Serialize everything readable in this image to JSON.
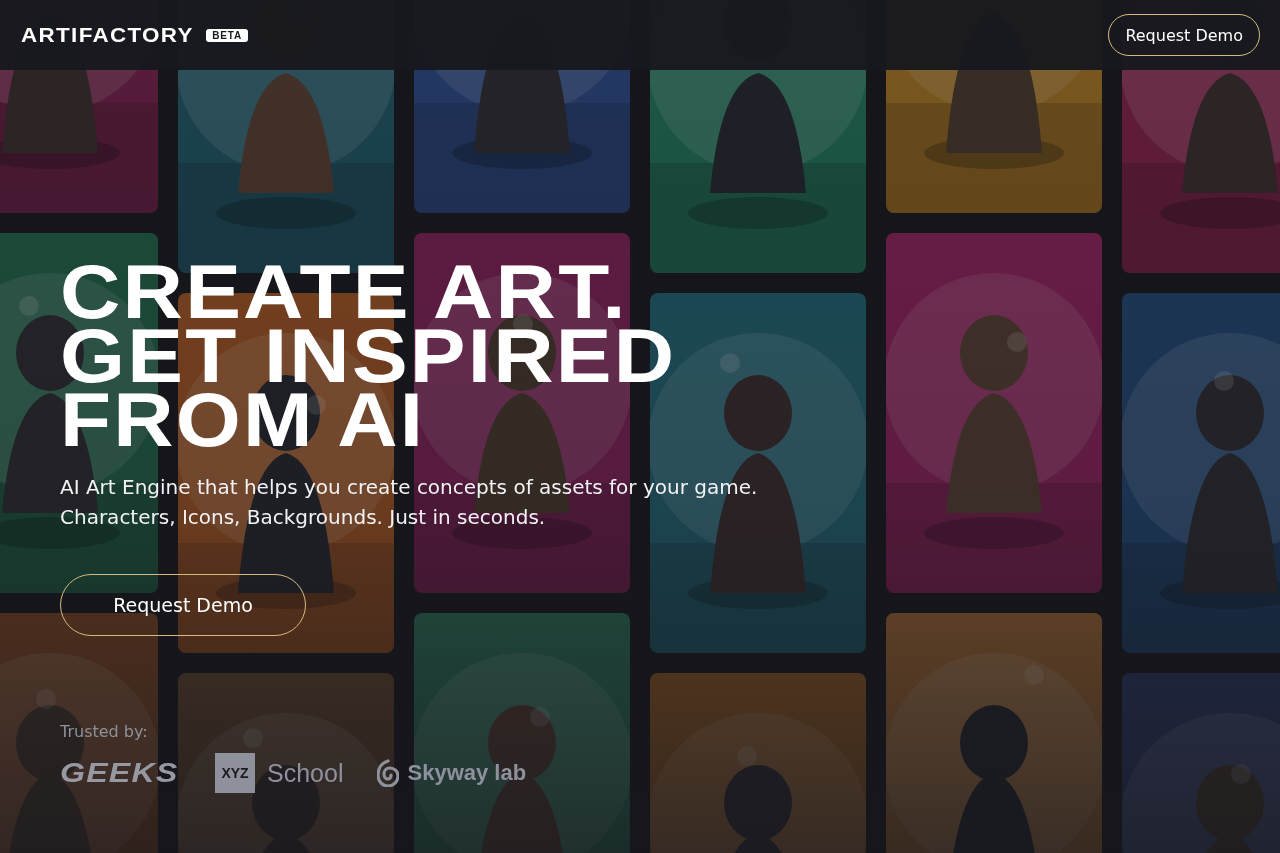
{
  "header": {
    "logo": "ARTIFACTORY",
    "badge": "BETA",
    "button": "Request Demo"
  },
  "hero": {
    "headline": [
      "CREATE ART.",
      "GET INSPIRED",
      "FROM AI"
    ],
    "subtitle": [
      "AI Art Engine that helps you create concepts of assets for your game.",
      "Characters, Icons, Backgrounds. Just in seconds."
    ],
    "button": "Request Demo"
  },
  "trusted": {
    "label": "Trusted by:",
    "logos": [
      {
        "kind": "wordmark",
        "text": "GEEKS"
      },
      {
        "kind": "boxed",
        "mark": "XYZ",
        "text": "School"
      },
      {
        "kind": "spiral",
        "text": "Skyway lab"
      }
    ]
  }
}
